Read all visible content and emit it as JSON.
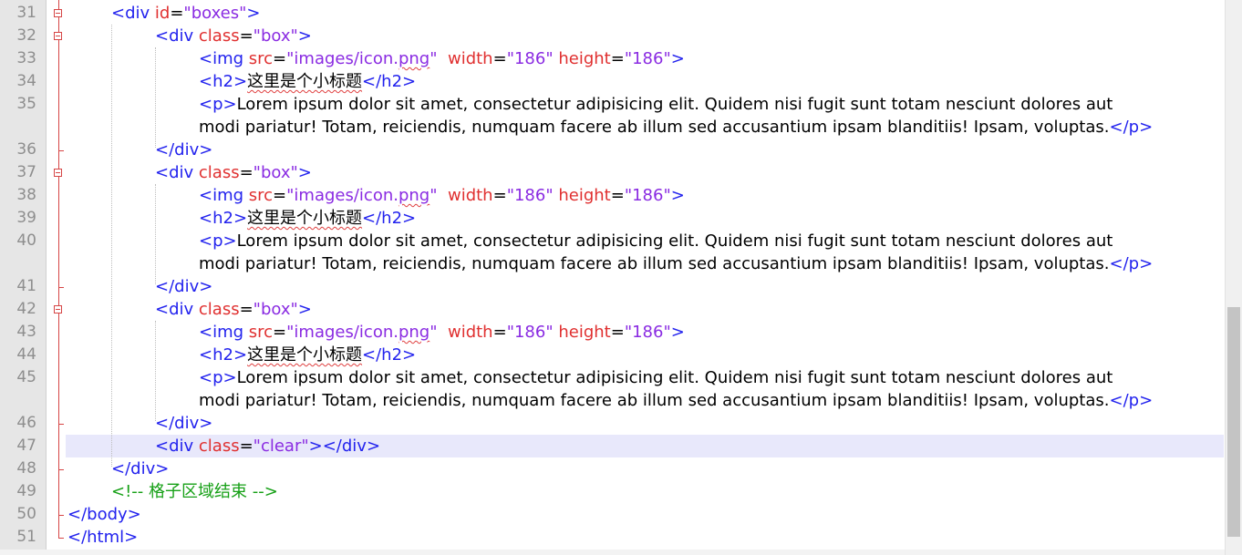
{
  "editor": {
    "line_numbers": [
      "31",
      "32",
      "33",
      "34",
      "35",
      "",
      "36",
      "37",
      "38",
      "39",
      "40",
      "",
      "41",
      "42",
      "43",
      "44",
      "45",
      "",
      "46",
      "47",
      "48",
      "49",
      "50",
      "51"
    ],
    "heading_text": "这里是个小标题",
    "paragraph_line1": "Lorem ipsum dolor sit amet, consectetur adipisicing elit. Quidem nisi fugit sunt totam nesciunt dolores aut",
    "paragraph_line2": "modi pariatur! Totam, reiciendis, numquam facere ab illum sed accusantium ipsam blanditiis! Ipsam, voluptas.",
    "comment_text": "<!-- 格子区域结束 -->",
    "current_line": "47"
  },
  "colors": {
    "tag": "#2222ee",
    "attribute": "#e03030",
    "attribute_value": "#8a2be2",
    "comment": "#16a016",
    "fold_marker": "#d64545",
    "current_line_bg": "#e8e8fb",
    "gutter_bg": "#e6e6e6"
  }
}
